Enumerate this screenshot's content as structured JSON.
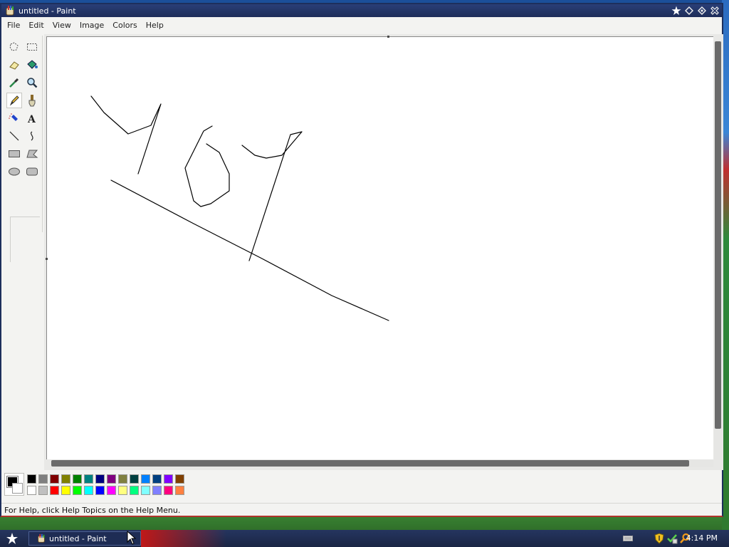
{
  "window": {
    "title": "untitled - Paint",
    "controls": [
      "star-icon",
      "minimize-icon",
      "maximize-icon",
      "close-icon"
    ]
  },
  "menu": {
    "items": [
      "File",
      "Edit",
      "View",
      "Image",
      "Colors",
      "Help"
    ]
  },
  "toolbox": {
    "tools": [
      "free-select-icon",
      "rect-select-icon",
      "eraser-icon",
      "fill-icon",
      "color-picker-icon",
      "magnifier-icon",
      "pencil-icon",
      "brush-icon",
      "airbrush-icon",
      "text-icon",
      "line-icon",
      "curve-icon",
      "rectangle-icon",
      "polygon-icon",
      "ellipse-icon",
      "rounded-rect-icon"
    ],
    "selected_tool": "pencil-icon"
  },
  "palette": {
    "foreground": "#000000",
    "background": "#ffffff",
    "top_row": [
      "#000000",
      "#808080",
      "#800000",
      "#808000",
      "#008000",
      "#008080",
      "#000080",
      "#800080",
      "#808040",
      "#004040",
      "#0080ff",
      "#004080",
      "#8000ff",
      "#804000"
    ],
    "bottom_row": [
      "#ffffff",
      "#c0c0c0",
      "#ff0000",
      "#ffff00",
      "#00ff00",
      "#00ffff",
      "#0000ff",
      "#ff00ff",
      "#ffff80",
      "#00ff80",
      "#80ffff",
      "#8080ff",
      "#ff0080",
      "#ff8040"
    ]
  },
  "status": {
    "text": "For Help, click Help Topics on the Help Menu."
  },
  "taskbar": {
    "task_label": "untitled - Paint",
    "clock": "4:14 PM",
    "tray_icons": [
      "keyboard-icon",
      "shield-icon",
      "network-icon",
      "search-icon"
    ]
  },
  "colors": {
    "title_bar": "#1d2c59",
    "window_border_bottom": "#b0332b",
    "scrollbar_thumb": "#6b6b6b"
  }
}
